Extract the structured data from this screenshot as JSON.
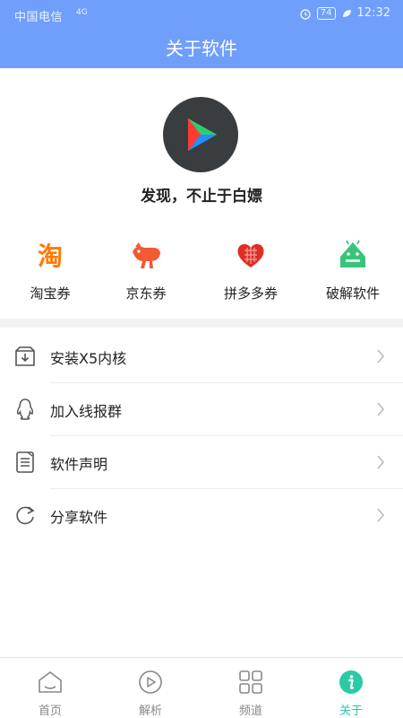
{
  "status_bar": {
    "carrier": "中国电信",
    "signal": "4G",
    "battery": "74",
    "time": "12:32"
  },
  "header": {
    "title": "关于软件"
  },
  "app": {
    "slogan": "发现，不止于白嫖"
  },
  "coupons": [
    {
      "label": "淘宝券",
      "icon": "taobao-icon",
      "glyph": "淘"
    },
    {
      "label": "京东券",
      "icon": "jd-dog-icon"
    },
    {
      "label": "拼多多券",
      "icon": "pinduoduo-heart-icon"
    },
    {
      "label": "破解软件",
      "icon": "android-icon"
    }
  ],
  "menu": [
    {
      "label": "安装X5内核",
      "icon": "download-box-icon"
    },
    {
      "label": "加入线报群",
      "icon": "qq-penguin-icon"
    },
    {
      "label": "软件声明",
      "icon": "document-icon"
    },
    {
      "label": "分享软件",
      "icon": "refresh-share-icon"
    }
  ],
  "tabs": [
    {
      "label": "首页",
      "icon": "home-icon",
      "active": false
    },
    {
      "label": "解析",
      "icon": "play-circle-icon",
      "active": false
    },
    {
      "label": "频道",
      "icon": "grid-icon",
      "active": false
    },
    {
      "label": "关于",
      "icon": "info-icon",
      "active": true
    }
  ],
  "colors": {
    "header": "#6f9ffb",
    "accent": "#2cc9a6",
    "taobao": "#ff7a00",
    "jd": "#f25a32",
    "pinduoduo": "#e02e24",
    "android": "#3ac37a"
  }
}
